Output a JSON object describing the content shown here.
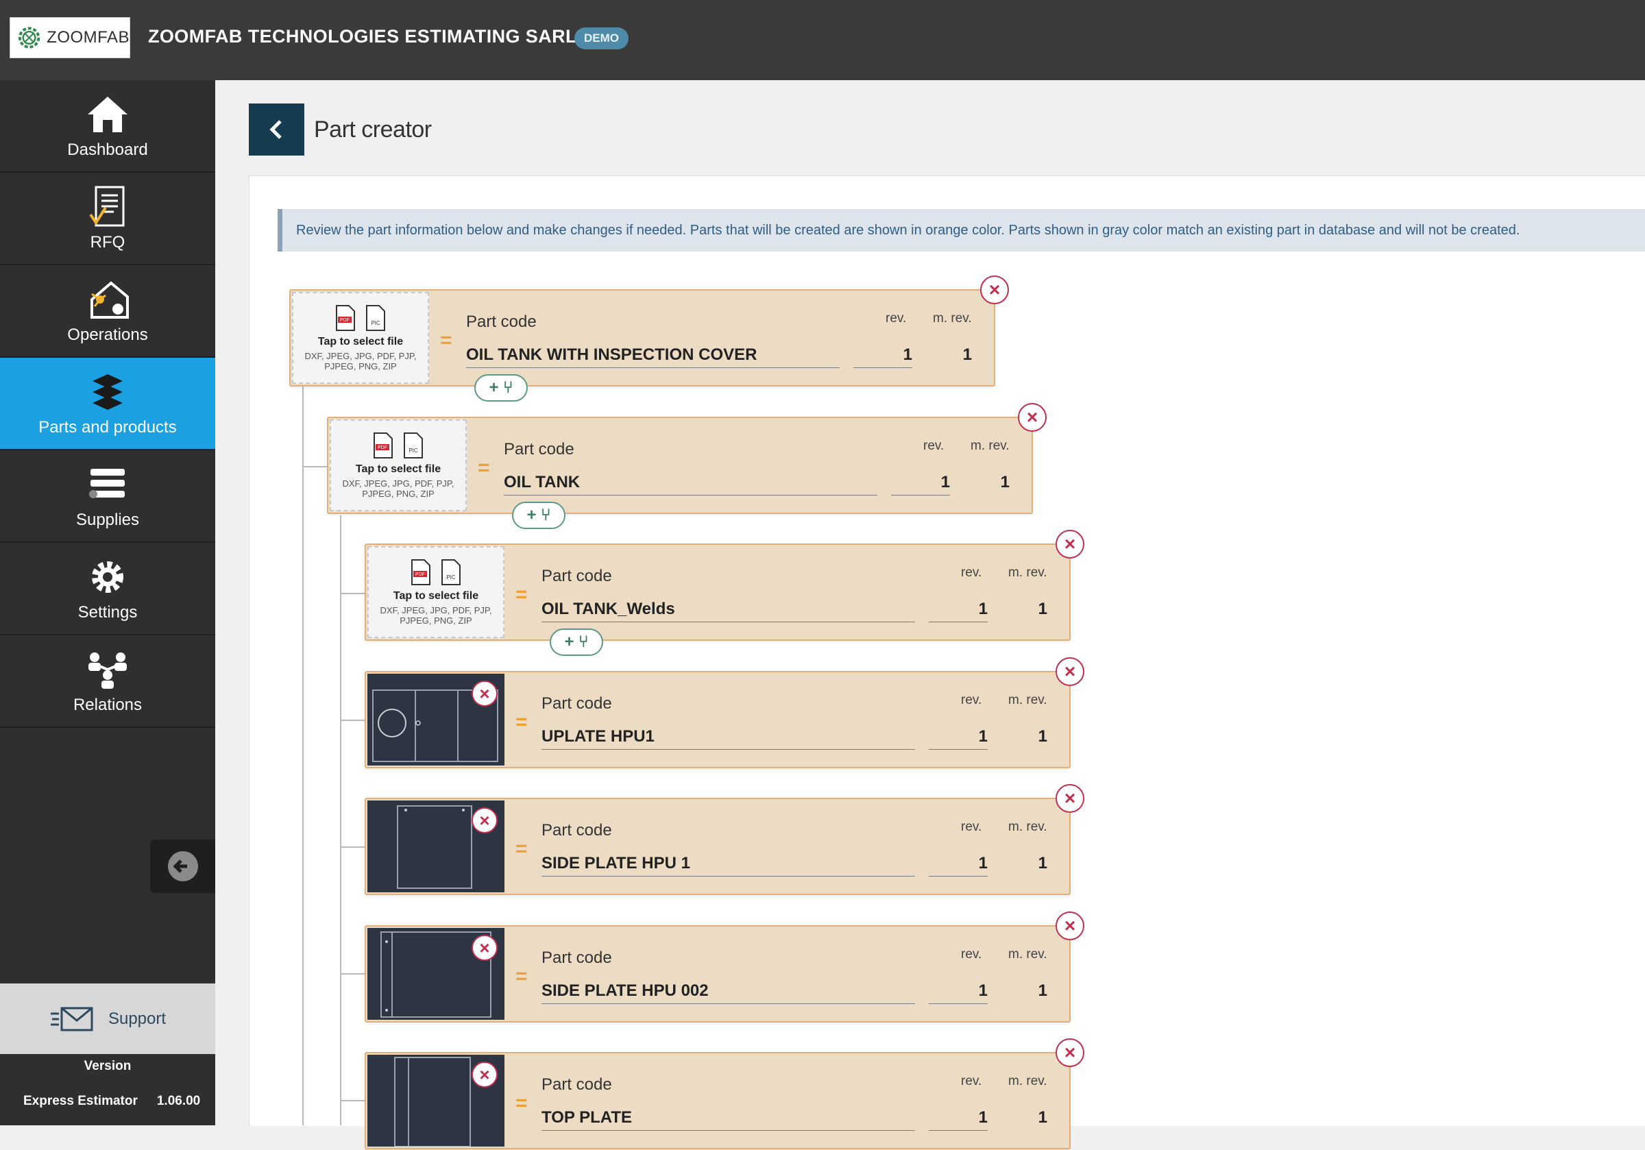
{
  "header": {
    "logo_text": "ZOOMFAB",
    "company_name": "ZOOMFAB TECHNOLOGIES ESTIMATING SARL",
    "badge": "DEMO"
  },
  "sidebar": {
    "items": [
      {
        "label": "Dashboard",
        "icon": "home-icon"
      },
      {
        "label": "RFQ",
        "icon": "rfq-document-icon"
      },
      {
        "label": "Operations",
        "icon": "operations-machine-icon"
      },
      {
        "label": "Parts and products",
        "icon": "parts-stack-icon",
        "active": true
      },
      {
        "label": "Supplies",
        "icon": "supplies-stack-icon"
      },
      {
        "label": "Settings",
        "icon": "gear-icon"
      },
      {
        "label": "Relations",
        "icon": "relations-people-icon"
      }
    ],
    "support_label": "Support",
    "version_title": "Version",
    "product_name": "Express Estimator",
    "version_number": "1.06.00"
  },
  "page": {
    "title": "Part creator",
    "info_message": "Review the part information below and make changes if needed. Parts that will be created are shown in orange color. Parts shown in gray color match an existing part in database and will not be created."
  },
  "labels": {
    "part_code": "Part code",
    "rev": "rev.",
    "m_rev": "m. rev.",
    "tap_select": "Tap to select file",
    "file_types": "DXF, JPEG, JPG, PDF, PJP, PJPEG, PNG, ZIP",
    "drag": "=",
    "add_child": "+ ⑂"
  },
  "parts": [
    {
      "code": "OIL TANK WITH INSPECTION COVER",
      "rev": "1",
      "m_rev": "1",
      "has_file": false,
      "level": 0
    },
    {
      "code": "OIL TANK",
      "rev": "1",
      "m_rev": "1",
      "has_file": false,
      "level": 1
    },
    {
      "code": "OIL TANK_Welds",
      "rev": "1",
      "m_rev": "1",
      "has_file": false,
      "level": 2
    },
    {
      "code": "UPLATE HPU1",
      "rev": "1",
      "m_rev": "1",
      "has_file": true,
      "level": 2
    },
    {
      "code": "SIDE PLATE HPU 1",
      "rev": "1",
      "m_rev": "1",
      "has_file": true,
      "level": 2
    },
    {
      "code": "SIDE PLATE HPU 002",
      "rev": "1",
      "m_rev": "1",
      "has_file": true,
      "level": 2
    },
    {
      "code": "TOP PLATE",
      "rev": "1",
      "m_rev": "1",
      "has_file": true,
      "level": 2
    }
  ],
  "colors": {
    "topbar": "#3a3a3a",
    "sidebar": "#2f2f2f",
    "active_nav": "#1ba1e2",
    "card_fill": "#ecdcc3",
    "card_border": "#e1b079",
    "delete_red": "#c03050"
  }
}
